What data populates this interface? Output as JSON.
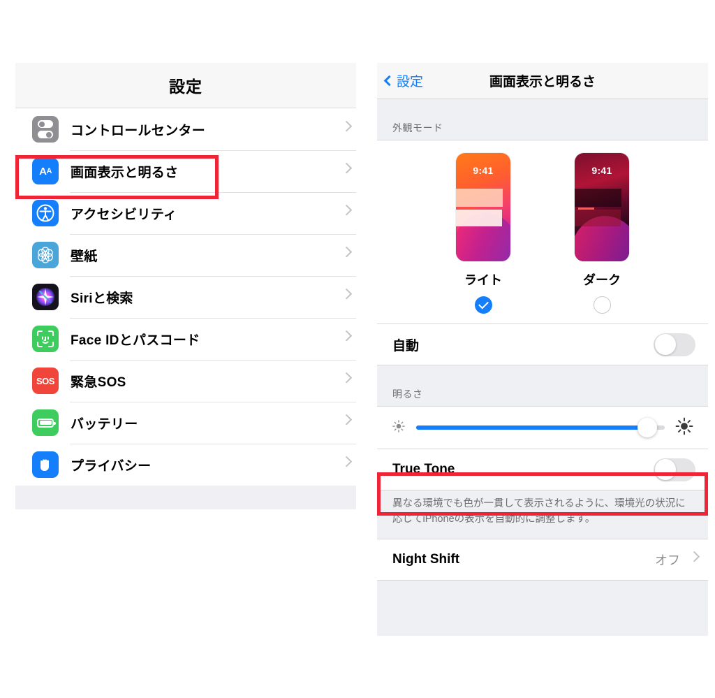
{
  "left": {
    "nav_title": "設定",
    "items": [
      {
        "label": "コントロールセンター",
        "icon": "control-center-icon",
        "color": "#8e8e93"
      },
      {
        "label": "画面表示と明るさ",
        "icon": "display-brightness-icon",
        "color": "#147efb"
      },
      {
        "label": "アクセシビリティ",
        "icon": "accessibility-icon",
        "color": "#147efb"
      },
      {
        "label": "壁紙",
        "icon": "wallpaper-icon",
        "color": "#4aa5d8"
      },
      {
        "label": "Siriと検索",
        "icon": "siri-icon",
        "color": "#16121d"
      },
      {
        "label": "Face IDとパスコード",
        "icon": "face-id-icon",
        "color": "#3ecc5f"
      },
      {
        "label": "緊急SOS",
        "icon": "emergency-sos-icon",
        "color": "#f0453a"
      },
      {
        "label": "バッテリー",
        "icon": "battery-icon",
        "color": "#3ecc5f"
      },
      {
        "label": "プライバシー",
        "icon": "privacy-hand-icon",
        "color": "#147efb"
      }
    ],
    "sos_glyph": "SOS"
  },
  "right": {
    "back_label": "設定",
    "nav_title": "画面表示と明るさ",
    "appearance_header": "外観モード",
    "previews": [
      {
        "label": "ライト",
        "time": "9:41",
        "selected": true
      },
      {
        "label": "ダーク",
        "time": "9:41",
        "selected": false
      }
    ],
    "auto_row": {
      "label": "自動",
      "toggle_on": false
    },
    "brightness_header": "明るさ",
    "brightness": {
      "value": 93,
      "min_icon": "sun-low-icon",
      "max_icon": "sun-high-icon"
    },
    "true_tone": {
      "label": "True Tone",
      "toggle_on": false
    },
    "true_tone_footnote": "異なる環境でも色が一貫して表示されるように、環境光の状況に応じてiPhoneの表示を自動的に調整します。",
    "night_shift": {
      "label": "Night Shift",
      "value": "オフ"
    }
  },
  "highlight_color": "#f02437"
}
